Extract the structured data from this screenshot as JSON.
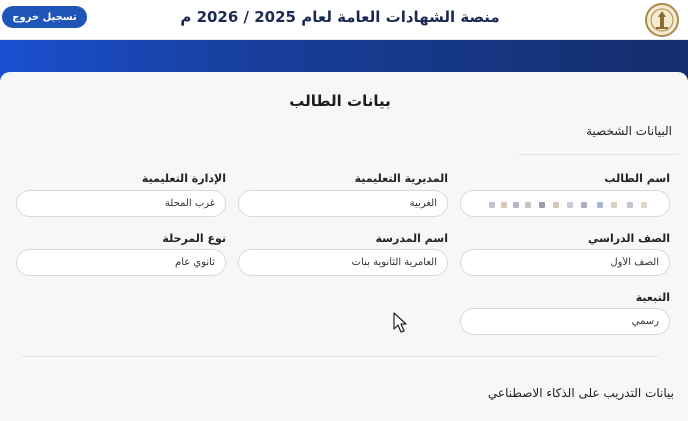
{
  "header": {
    "title": "منصة الشهادات العامة لعام 2025 / 2026 م",
    "logout_label": "تسجيل خروج"
  },
  "card": {
    "title": "بيانات الطالب",
    "personal_heading": "البيانات الشخصية",
    "ai_training_heading": "بيانات التدريب على الذكاء الاصطناعي"
  },
  "fields": {
    "student_name": {
      "label": "اسم الطالب",
      "value": ""
    },
    "directorate": {
      "label": "المديرية التعليمية",
      "value": "الغربية"
    },
    "administration": {
      "label": "الإدارة التعليمية",
      "value": "غرب المحلة"
    },
    "grade": {
      "label": "الصف الدراسي",
      "value": "الصف الأول"
    },
    "school": {
      "label": "اسم المدرسة",
      "value": "العامرية الثانوية بنات"
    },
    "stage_type": {
      "label": "نوع المرحلة",
      "value": "ثانوي عام"
    },
    "affiliation": {
      "label": "التبعية",
      "value": "رسمي"
    }
  },
  "colors": {
    "primary": "#1f55b8",
    "banner_start": "#1a4fd1",
    "banner_end": "#142d6b",
    "title_color": "#1d2b53"
  },
  "icons": {
    "logo": "ministry-seal-icon",
    "cursor": "mouse-pointer-icon"
  }
}
